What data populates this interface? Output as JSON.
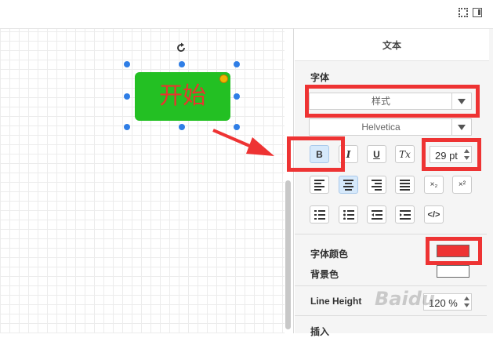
{
  "panel": {
    "title": "文本",
    "font_section_label": "字体",
    "style_select": "样式",
    "font_family_select": "Helvetica",
    "font_size": "29 pt",
    "format_buttons": {
      "bold": "B",
      "italic": "I",
      "underline": "U",
      "clear": "Tx"
    },
    "script_buttons": {
      "subscript": "×₂",
      "superscript": "×²",
      "html": "</>"
    },
    "font_color_label": "字体颜色",
    "background_color_label": "背景色",
    "line_height_label": "Line Height",
    "line_height_value": "120 %",
    "insert_label": "插入",
    "font_color": "#ee3333",
    "background_color": "#ffffff"
  },
  "canvas": {
    "shape_text": "开始",
    "shape_fill": "#23c023",
    "shape_text_color": "#e8352e"
  },
  "watermark": "Baidu"
}
